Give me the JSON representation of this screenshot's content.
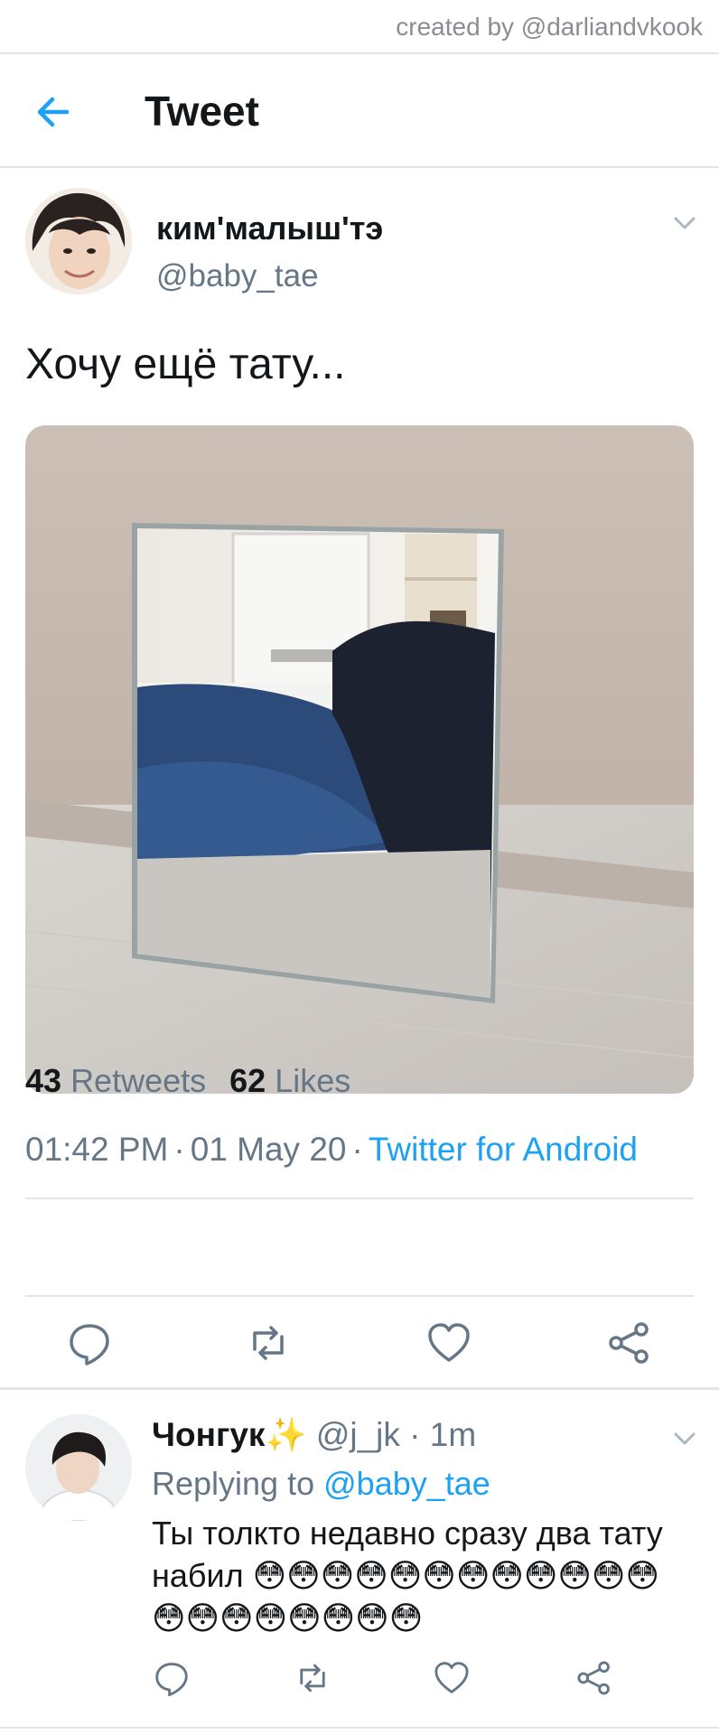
{
  "watermark": "created by @darliandvkook",
  "header": {
    "title": "Tweet",
    "back_icon": "arrow-left-icon"
  },
  "tweet": {
    "display_name": "ким'малыш'тэ",
    "handle": "@baby_tae",
    "text": "Хочу ещё тату...",
    "time": "01:42 PM",
    "date": "01 May 20",
    "source": "Twitter for Android",
    "retweets_count": "43",
    "retweets_label": "Retweets",
    "likes_count": "62",
    "likes_label": "Likes"
  },
  "reply": {
    "display_name": "Чонгук",
    "sparkle": "✨",
    "handle": "@j_jk",
    "time": "1m",
    "replying_prefix": "Replying to",
    "replying_to": "@baby_tae",
    "text": "Ты толкто недавно сразу два тату набил 😳😳😳😳😳😳😳😳😳😳😳😳😳😳😳😳😳😳😳😳"
  },
  "colors": {
    "accent": "#1da1f2",
    "muted": "#657786",
    "text": "#14171a",
    "divider": "#e1e4e8"
  }
}
